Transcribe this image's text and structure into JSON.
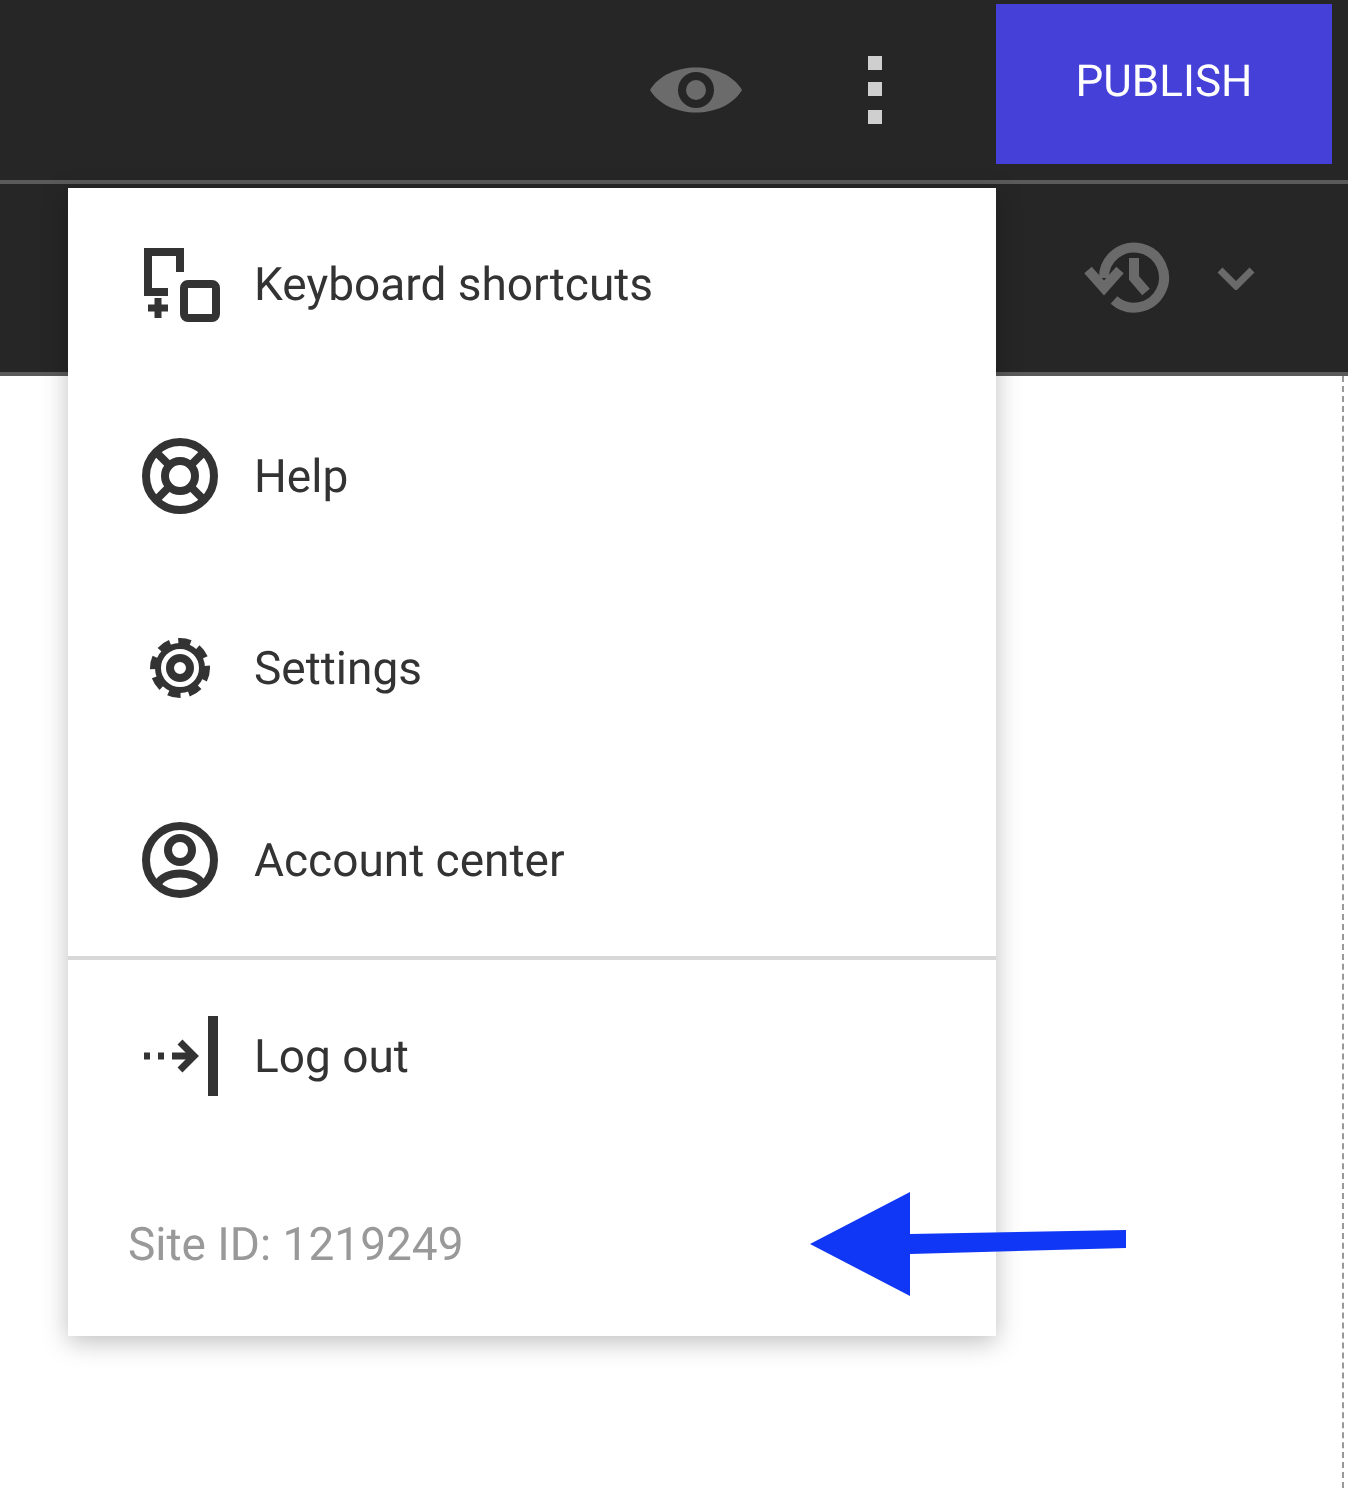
{
  "toolbar": {
    "publish_button": "PUBLISH"
  },
  "menu": {
    "sections": [
      {
        "items": [
          {
            "label": "Keyboard shortcuts",
            "kind": "shortcuts"
          },
          {
            "label": "Help",
            "kind": "help"
          },
          {
            "label": "Settings",
            "kind": "settings"
          },
          {
            "label": "Account center",
            "kind": "account"
          }
        ]
      },
      {
        "items": [
          {
            "label": "Log out",
            "kind": "logout"
          }
        ]
      }
    ],
    "site_id": "Site ID: 1219249"
  }
}
